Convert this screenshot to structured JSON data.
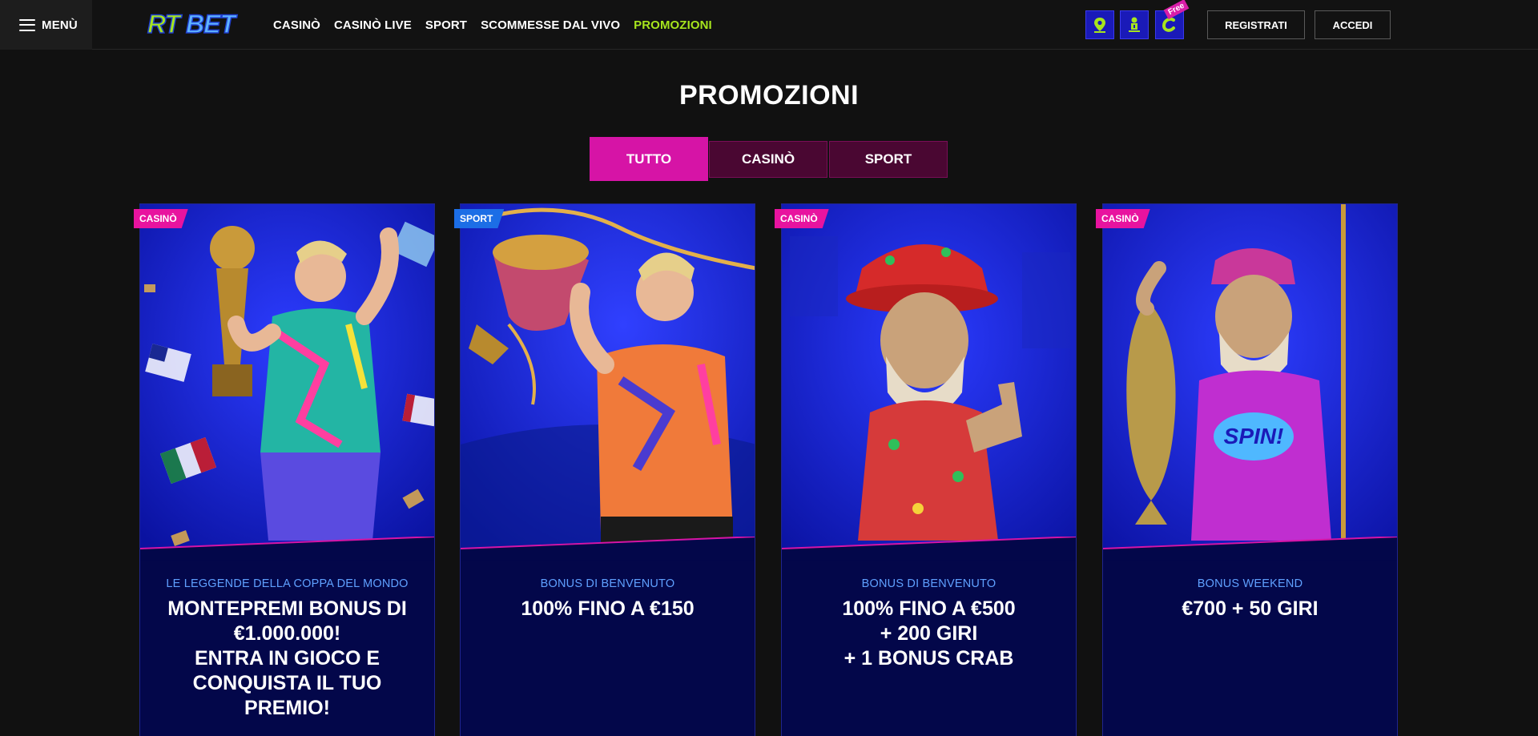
{
  "header": {
    "menu_label": "MENÙ",
    "logo_text": "RTBET",
    "nav": [
      {
        "label": "CASINÒ",
        "active": false
      },
      {
        "label": "CASINÒ LIVE",
        "active": false
      },
      {
        "label": "SPORT",
        "active": false
      },
      {
        "label": "SCOMMESSE DAL VIVO",
        "active": false
      },
      {
        "label": "PROMOZIONI",
        "active": true
      }
    ],
    "icons": [
      "location-icon",
      "user-support-icon",
      "free-coin-icon"
    ],
    "free_badge": "Free",
    "register_label": "REGISTRATI",
    "login_label": "ACCEDI"
  },
  "page": {
    "title": "PROMOZIONI",
    "tabs": [
      {
        "label": "TUTTO",
        "active": true
      },
      {
        "label": "CASINÒ",
        "active": false
      },
      {
        "label": "SPORT",
        "active": false
      }
    ]
  },
  "promotions": [
    {
      "badge": "CASINÒ",
      "badge_type": "casino",
      "subtitle": "LE LEGGENDE DELLA COPPA DEL MONDO",
      "title": "MONTEPREMI BONUS DI\n€1.000.000!\nENTRA IN GIOCO E\nCONQUISTA IL TUO\nPREMIO!",
      "image": "football-champion-trophy-illustration"
    },
    {
      "badge": "SPORT",
      "badge_type": "sport",
      "subtitle": "BONUS DI BENVENUTO",
      "title": "100% FINO A €150",
      "image": "sports-player-trophy-illustration"
    },
    {
      "badge": "CASINÒ",
      "badge_type": "casino",
      "subtitle": "BONUS DI BENVENUTO",
      "title": "100% FINO A €500\n+ 200 GIRI\n+ 1 BONUS CRAB",
      "image": "fisherman-thumbs-up-illustration"
    },
    {
      "badge": "CASINÒ",
      "badge_type": "casino",
      "subtitle": "BONUS WEEKEND",
      "title": "€700 + 50 GIRI",
      "image": "fisherman-holding-fish-illustration"
    }
  ],
  "colors": {
    "background": "#111111",
    "accent_green": "#a7e51d",
    "accent_pink": "#d614a6",
    "card_blue": "#03074a",
    "icon_blue": "#1a1ab8",
    "subtitle_blue": "#5fa0ff"
  }
}
